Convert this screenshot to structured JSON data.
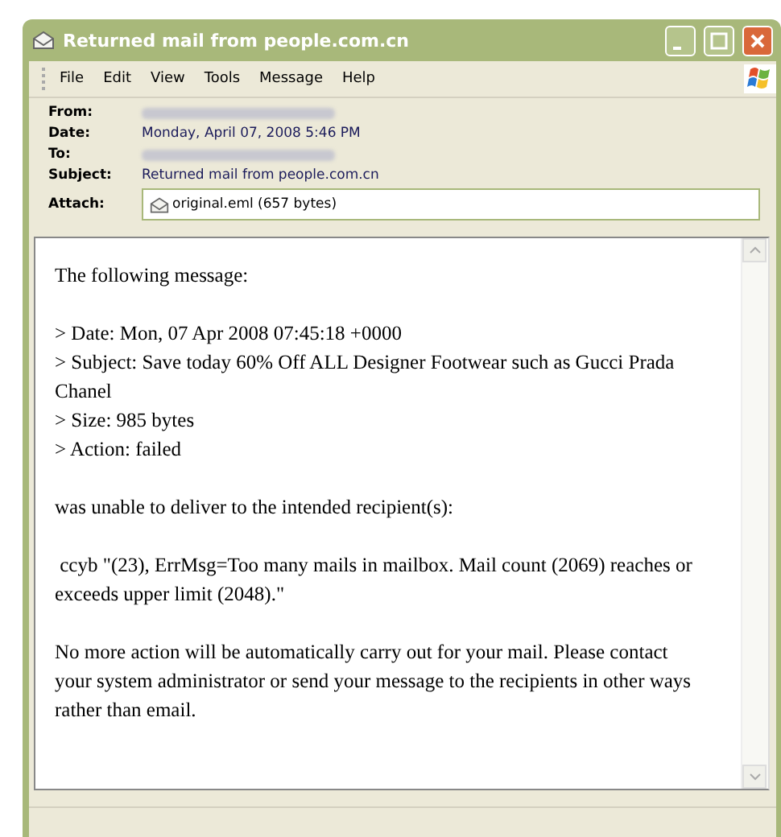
{
  "window": {
    "title": "Returned mail from people.com.cn"
  },
  "menu": [
    "File",
    "Edit",
    "View",
    "Tools",
    "Message",
    "Help"
  ],
  "header": [
    {
      "label": "From:",
      "kind": "redacted"
    },
    {
      "label": "Date:",
      "kind": "text",
      "value": "Monday, April 07, 2008 5:46 PM"
    },
    {
      "label": "To:",
      "kind": "redacted"
    },
    {
      "label": "Subject:",
      "kind": "text",
      "value": "Returned mail from people.com.cn"
    },
    {
      "label": "Attach:",
      "kind": "attachment",
      "value": "original.eml (657 bytes)"
    }
  ],
  "body": [
    [
      "The following message:"
    ],
    [
      "> Date: Mon, 07 Apr 2008 07:45:18 +0000",
      "> Subject: Save today 60% Off ALL Designer Footwear such as Gucci Prada Chanel",
      "> Size: 985 bytes",
      "> Action: failed"
    ],
    [
      "was unable to deliver to the intended recipient(s):"
    ],
    [
      " ccyb \"(23), ErrMsg=Too many mails in mailbox. Mail count (2069) reaches or exceeds upper limit (2048).\""
    ],
    [
      "No more action will be automatically carry out for your mail. Please contact your system administrator or send your message to the recipients in other ways rather than email."
    ]
  ]
}
